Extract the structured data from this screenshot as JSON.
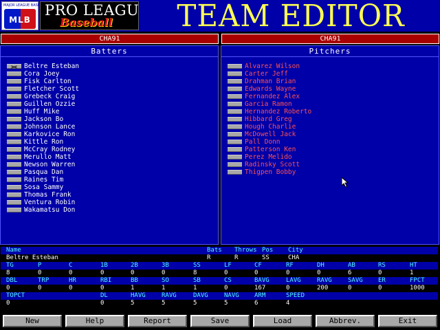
{
  "header": {
    "mlb_logo_top": "MAJOR LEAGUE BASEBALL",
    "mlb_logo_text": "MLB",
    "logo_line1": "PRO LEAGUE",
    "logo_line2": "Baseball",
    "title": "TEAM EDITOR"
  },
  "teams": {
    "left": "CHA91",
    "right": "CHA91"
  },
  "batters": {
    "title": "Batters",
    "players": [
      {
        "name": "Beltre Esteban",
        "checked": true
      },
      {
        "name": "Cora Joey",
        "checked": false
      },
      {
        "name": "Fisk Carlton",
        "checked": false
      },
      {
        "name": "Fletcher Scott",
        "checked": false
      },
      {
        "name": "Grebeck Craig",
        "checked": false
      },
      {
        "name": "Guillen Ozzie",
        "checked": false
      },
      {
        "name": "Huff Mike",
        "checked": false
      },
      {
        "name": "Jackson Bo",
        "checked": false
      },
      {
        "name": "Johnson Lance",
        "checked": false
      },
      {
        "name": "Karkovice Ron",
        "checked": false
      },
      {
        "name": "Kittle Ron",
        "checked": false
      },
      {
        "name": "McCray Rodney",
        "checked": false
      },
      {
        "name": "Merullo Matt",
        "checked": false
      },
      {
        "name": "Newson Warren",
        "checked": false
      },
      {
        "name": "Pasqua Dan",
        "checked": false
      },
      {
        "name": "Raines Tim",
        "checked": false
      },
      {
        "name": "Sosa Sammy",
        "checked": false
      },
      {
        "name": "Thomas Frank",
        "checked": false
      },
      {
        "name": "Ventura Robin",
        "checked": false
      },
      {
        "name": "Wakamatsu Don",
        "checked": false
      }
    ]
  },
  "pitchers": {
    "title": "Pitchers",
    "players": [
      {
        "name": "Alvarez Wilson",
        "checked": false
      },
      {
        "name": "Carter Jeff",
        "checked": false
      },
      {
        "name": "Drahman Brian",
        "checked": false
      },
      {
        "name": "Edwards Wayne",
        "checked": false
      },
      {
        "name": "Fernandez Alex",
        "checked": false
      },
      {
        "name": "Garcia Ramon",
        "checked": false
      },
      {
        "name": "Hernandez Roberto",
        "checked": false
      },
      {
        "name": "Hibbard Greg",
        "checked": false
      },
      {
        "name": "Hough Charlie",
        "checked": false
      },
      {
        "name": "McDowell Jack",
        "checked": false
      },
      {
        "name": "Pall Donn",
        "checked": false
      },
      {
        "name": "Patterson Ken",
        "checked": false
      },
      {
        "name": "Perez Melido",
        "checked": false
      },
      {
        "name": "Radinsky Scott",
        "checked": false
      },
      {
        "name": "Thigpen Bobby",
        "checked": false
      }
    ]
  },
  "stats": {
    "info_headers": [
      "Name",
      "Bats",
      "Throws",
      "Pos",
      "City"
    ],
    "info_values": [
      "Beltre Esteban",
      "R",
      "R",
      "SS",
      "CHA"
    ],
    "row1_headers": [
      "TG",
      "P",
      "C",
      "1B",
      "2B",
      "3B",
      "SS",
      "LF",
      "CF",
      "RF",
      "DH",
      "AB",
      "RS",
      "HT"
    ],
    "row1_values": [
      "8",
      "0",
      "0",
      "0",
      "0",
      "0",
      "8",
      "0",
      "0",
      "0",
      "0",
      "6",
      "0",
      "1"
    ],
    "row2_headers": [
      "DBL",
      "TRP",
      "HR",
      "RBI",
      "BB",
      "SO",
      "SB",
      "CS",
      "BAVG",
      "LAVG",
      "RAVG",
      "SAVG",
      "ER",
      "FPCT"
    ],
    "row2_values": [
      "0",
      "0",
      "0",
      "0",
      "1",
      "1",
      "1",
      "0",
      "167",
      "0",
      "200",
      "0",
      "0",
      "1000"
    ],
    "row3_headers": [
      "TOPCT",
      "DL",
      "HAVG",
      "RAVG",
      "DAVG",
      "NAVG",
      "ARM",
      "SPEED"
    ],
    "row3_values": [
      "0",
      "0",
      "5",
      "5",
      "5",
      "5",
      "6",
      "4"
    ]
  },
  "buttons": [
    "New",
    "Help",
    "Report",
    "Save",
    "Load",
    "Abbrev.",
    "Exit"
  ],
  "colors": {
    "header_bg": "#0000a8",
    "title": "#ffff54",
    "team_bar": "#a80000",
    "batter_text": "#ffffff",
    "pitcher_text": "#fc5454",
    "stat_header_text": "#54fcfc",
    "button_face": "#a8a8a8"
  },
  "icons": {
    "cursor": "arrow-cursor-icon",
    "checkbox_checked": "x-mark-icon"
  }
}
